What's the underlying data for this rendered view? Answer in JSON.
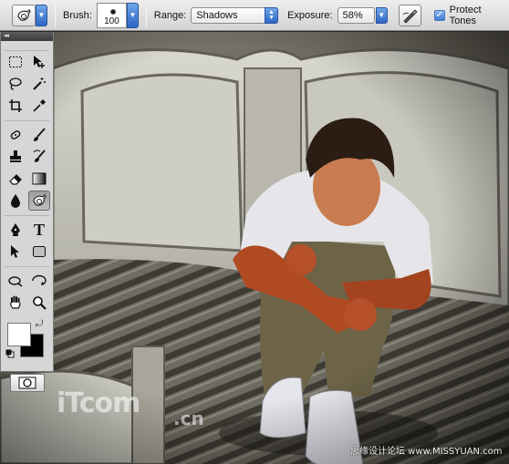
{
  "options_bar": {
    "tool_preset_icon": "dodge-burn-sponge-icon",
    "brush_label": "Brush:",
    "brush_size": "100",
    "range_label": "Range:",
    "range_value": "Shadows",
    "exposure_label": "Exposure:",
    "exposure_value": "58%",
    "airbrush_icon": "airbrush-icon",
    "protect_tones_label": "Protect Tones",
    "protect_tones_checked": true
  },
  "tools_panel": {
    "collapse_glyph": "◂◂",
    "tools": [
      [
        "marquee-icon",
        "move-icon"
      ],
      [
        "lasso-icon",
        "magic-wand-icon"
      ],
      [
        "crop-icon",
        "eyedropper-icon"
      ],
      [
        "healing-brush-icon",
        "brush-icon"
      ],
      [
        "clone-stamp-icon",
        "history-brush-icon"
      ],
      [
        "eraser-icon",
        "gradient-icon"
      ],
      [
        "blur-icon",
        "dodge-icon"
      ],
      [
        "pen-icon",
        "type-icon"
      ],
      [
        "path-selection-icon",
        "rectangle-shape-icon"
      ],
      [
        "3d-rotate-icon",
        "3d-orbit-icon"
      ],
      [
        "hand-icon",
        "zoom-icon"
      ]
    ],
    "active_tool": "dodge-icon",
    "foreground_color": "#ffffff",
    "background_color": "#000000",
    "type_tool_glyph": "T"
  },
  "watermarks": {
    "left_main": "iTcom",
    "left_sub": ".cn",
    "right": "思缘设计论坛 www.MISSYUAN.com"
  }
}
